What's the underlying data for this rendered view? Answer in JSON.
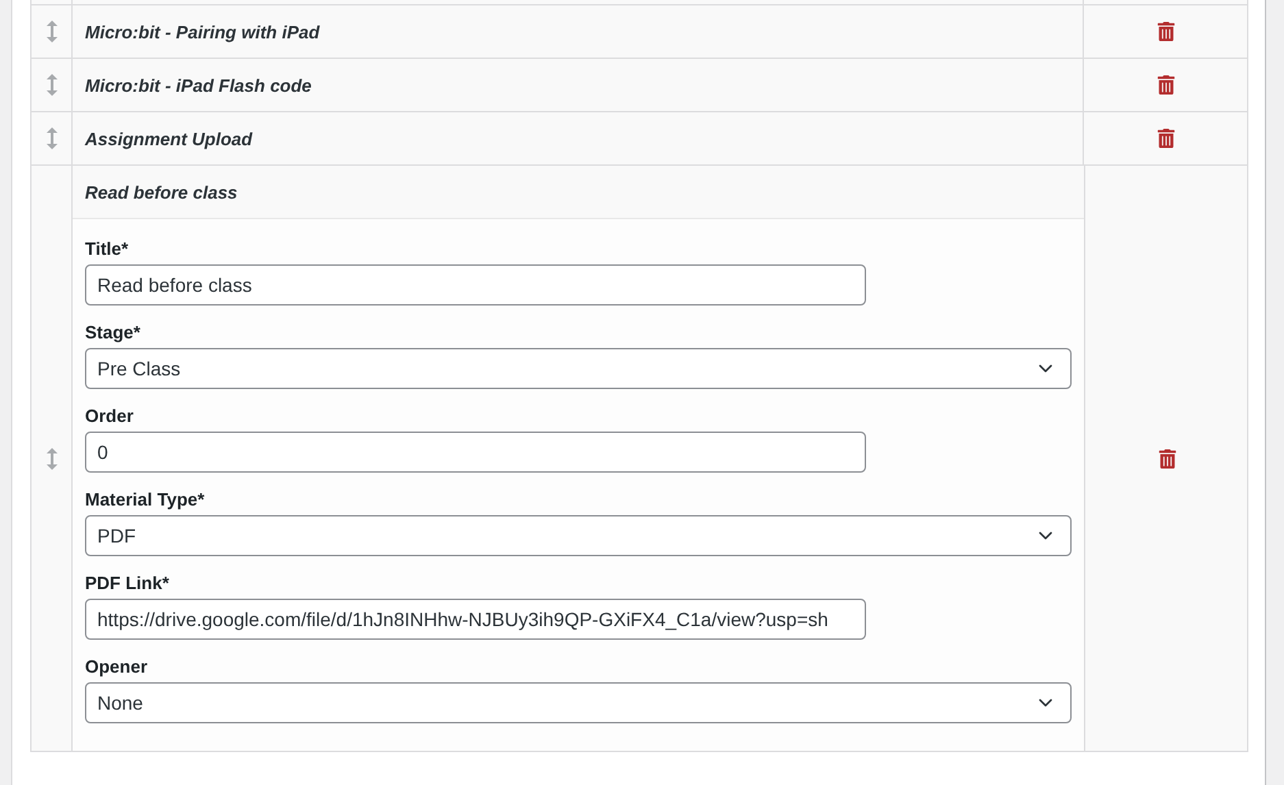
{
  "items": [
    {
      "title": "Micro:bit - Pairing with iPad",
      "expanded": false
    },
    {
      "title": "Micro:bit - iPad Flash code",
      "expanded": false
    },
    {
      "title": "Assignment Upload",
      "expanded": false
    },
    {
      "title": "Read before class",
      "expanded": true,
      "fields": [
        {
          "kind": "text",
          "label": "Title*",
          "value": "Read before class"
        },
        {
          "kind": "select",
          "label": "Stage*",
          "value": "Pre Class"
        },
        {
          "kind": "text",
          "label": "Order",
          "value": "0"
        },
        {
          "kind": "select",
          "label": "Material Type*",
          "value": "PDF"
        },
        {
          "kind": "text",
          "label": "PDF Link*",
          "value": "https://drive.google.com/file/d/1hJn8INHhw-NJBUy3ih9QP-GXiFX4_C1a/view?usp=sh"
        },
        {
          "kind": "select",
          "label": "Opener",
          "value": "None"
        }
      ]
    }
  ]
}
